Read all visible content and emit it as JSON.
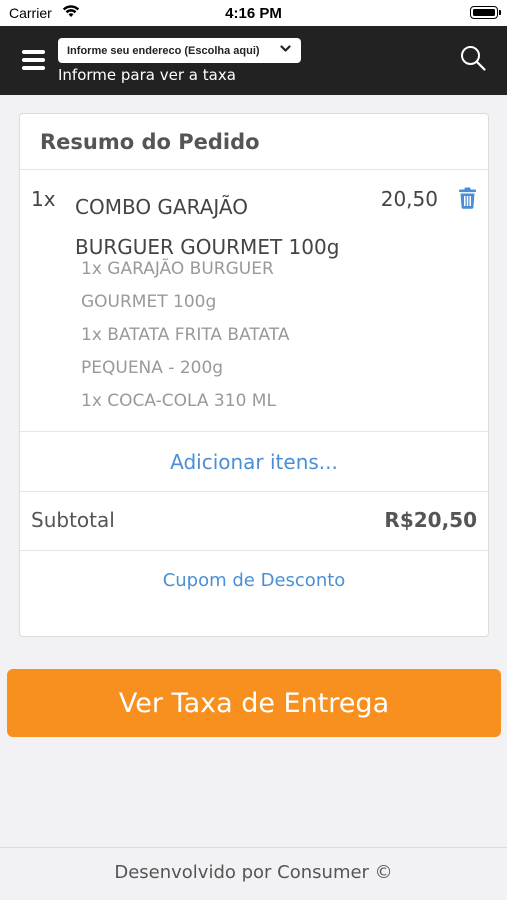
{
  "status_bar": {
    "carrier": "Carrier",
    "time": "4:16 PM"
  },
  "header": {
    "address_select": "Informe seu endereco (Escolha aqui)",
    "subtitle": "Informe para ver a taxa"
  },
  "order": {
    "title": "Resumo do Pedido",
    "item": {
      "qty": "1x",
      "name_line1": "COMBO GARAJÃO",
      "name_line2": "BURGUER GOURMET 100g",
      "price": "20,50",
      "subitems": [
        "1x GARAJÃO BURGUER",
        "GOURMET 100g",
        "1x BATATA FRITA BATATA",
        "PEQUENA - 200g",
        "1x COCA-COLA 310 ML"
      ]
    },
    "add_items": "Adicionar itens...",
    "subtotal_label": "Subtotal",
    "subtotal_value": "R$20,50",
    "coupon": "Cupom de Desconto"
  },
  "cta_label": "Ver Taxa de Entrega",
  "footer": "Desenvolvido por Consumer ©",
  "colors": {
    "accent": "#f7901e",
    "link": "#4a8fd6",
    "header_bg": "#222222"
  }
}
